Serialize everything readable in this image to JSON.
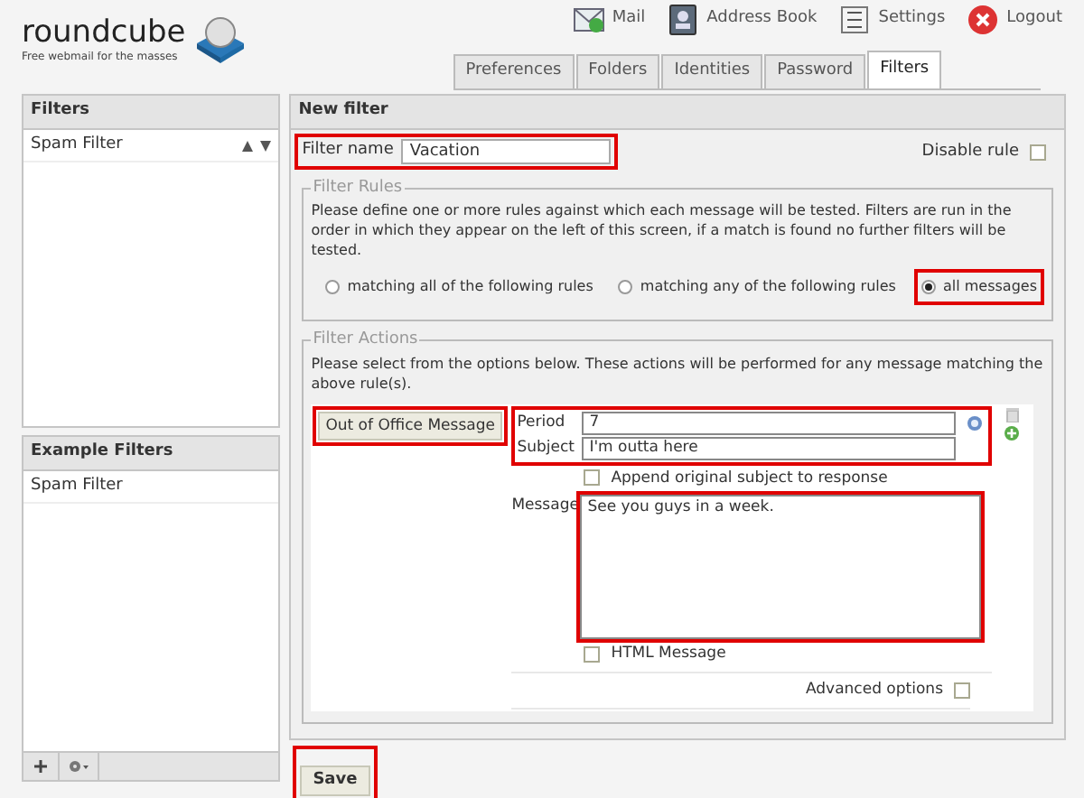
{
  "header": {
    "logo": "roundcube",
    "tagline": "Free webmail for the masses",
    "nav": [
      {
        "kind": "mail",
        "label": "Mail"
      },
      {
        "kind": "contacts",
        "label": "Address Book"
      },
      {
        "kind": "settings",
        "label": "Settings"
      },
      {
        "kind": "logout",
        "label": "Logout"
      }
    ]
  },
  "tabs": [
    {
      "label": "Preferences",
      "selected": false
    },
    {
      "label": "Folders",
      "selected": false
    },
    {
      "label": "Identities",
      "selected": false
    },
    {
      "label": "Password",
      "selected": false
    },
    {
      "label": "Filters",
      "selected": true
    }
  ],
  "filters_panel": {
    "title": "Filters",
    "items": [
      {
        "label": "Spam Filter",
        "selected": false
      }
    ]
  },
  "example_filters": {
    "title": "Example Filters",
    "items": [
      {
        "label": "Spam Filter",
        "selected": false
      }
    ]
  },
  "new_filter": {
    "title": "New filter",
    "filter_name": {
      "label": "Filter name",
      "value": "Vacation",
      "highlighted": true
    },
    "disable_rule": {
      "label": "Disable rule",
      "checked": false
    },
    "rules": {
      "legend": "Filter Rules",
      "description": "Please define one or more rules against which each message will be tested. Filters are run in the order in which they appear on the left of this screen, if a match is found no further filters will be tested.",
      "options": [
        {
          "label": "matching all of the following rules",
          "selected": false,
          "highlighted": false
        },
        {
          "label": "matching any of the following rules",
          "selected": false,
          "highlighted": false
        },
        {
          "label": "all messages",
          "selected": true,
          "highlighted": true
        }
      ]
    },
    "actions": {
      "legend": "Filter Actions",
      "description": "Please select from the options below. These actions will be performed for any message matching the above rule(s).",
      "action_select": {
        "value": "Out of Office Message",
        "highlighted": true
      },
      "fields_highlighted": true,
      "period": {
        "label": "Period",
        "value": "7"
      },
      "subject": {
        "label": "Subject",
        "value": "I'm outta here"
      },
      "append": {
        "label": "Append original subject to response",
        "checked": false
      },
      "message": {
        "label": "Message",
        "value": "See you guys in a week.",
        "highlighted": true
      },
      "html": {
        "label": "HTML Message",
        "checked": false
      },
      "advanced": {
        "label": "Advanced options",
        "checked": false
      }
    }
  },
  "save": {
    "label": "Save",
    "highlighted": true
  }
}
